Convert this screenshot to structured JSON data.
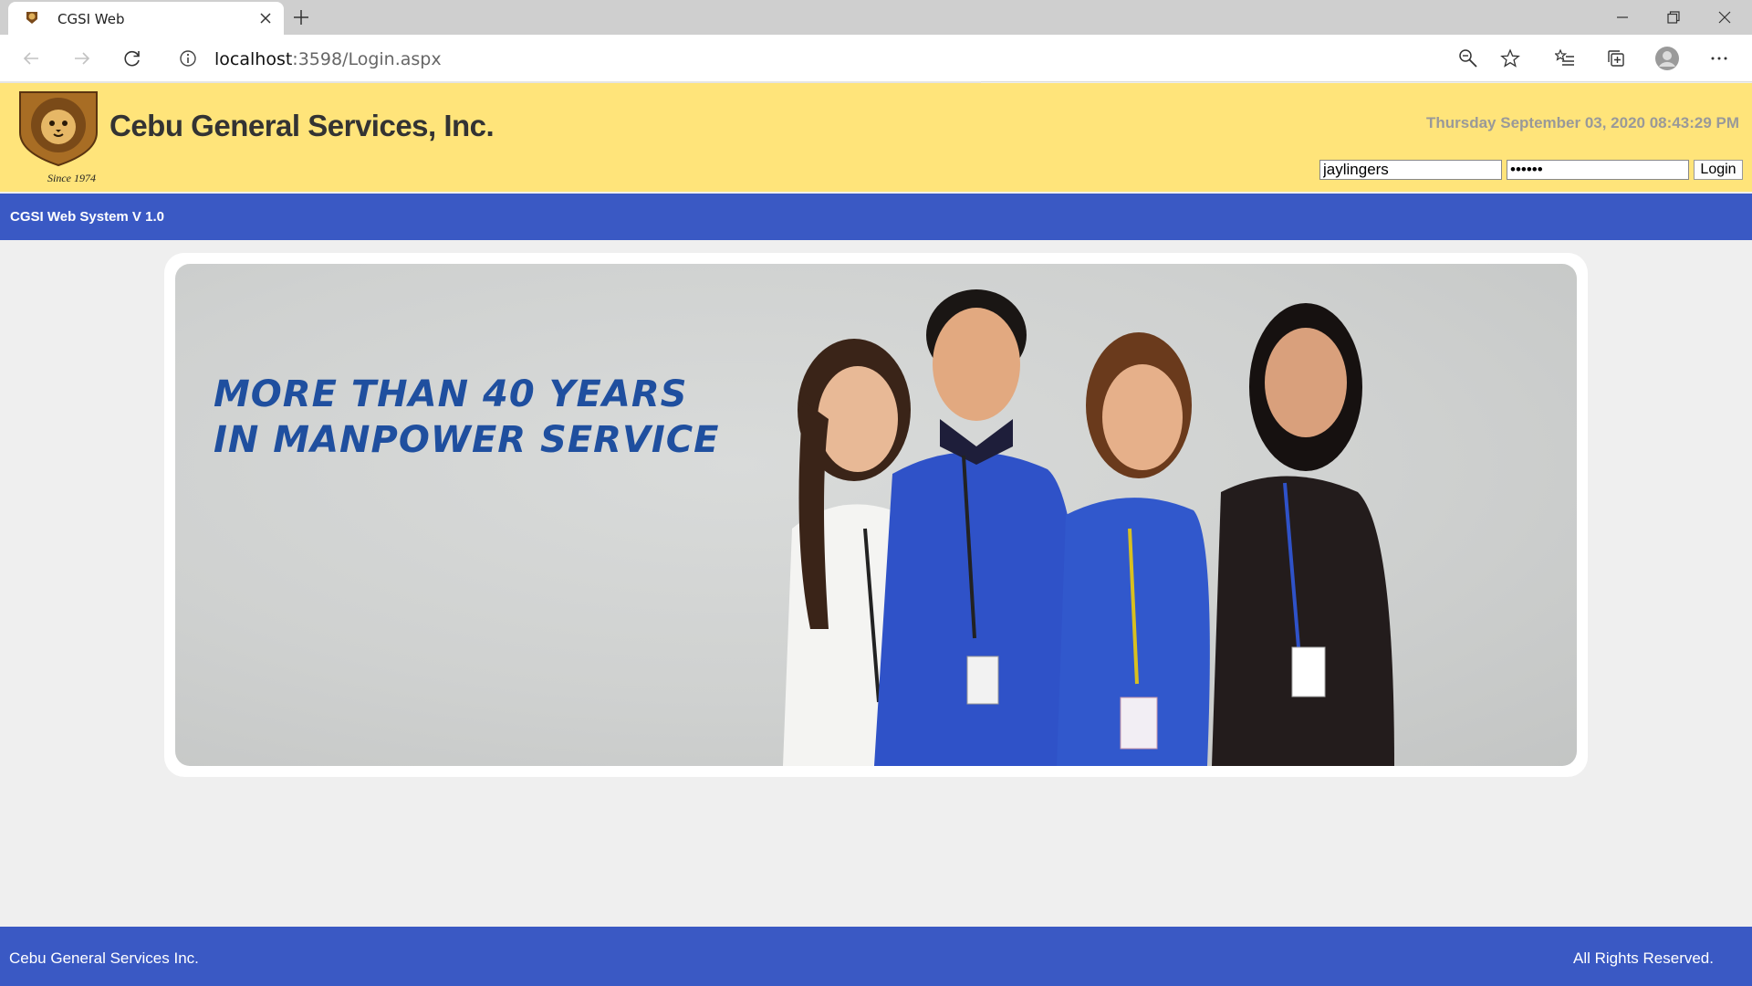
{
  "browser": {
    "tab_title": "CGSI Web",
    "url_host": "localhost",
    "url_path": ":3598/Login.aspx"
  },
  "header": {
    "company_name": "Cebu General Services, Inc.",
    "logo_since": "Since 1974",
    "datetime": "Thursday September 03, 2020 08:43:29 PM"
  },
  "login": {
    "username_value": "jaylingers",
    "password_value": "••••••",
    "button_label": "Login"
  },
  "navbar": {
    "title": "CGSI Web System V 1.0"
  },
  "banner": {
    "line1": "More than 40 years",
    "line2": "in manpower service"
  },
  "footer": {
    "left": "Cebu General Services Inc.",
    "right": "All Rights Reserved."
  },
  "colors": {
    "header_bg": "#ffe47a",
    "nav_bg": "#3a59c4",
    "banner_text": "#1f4f9f"
  }
}
